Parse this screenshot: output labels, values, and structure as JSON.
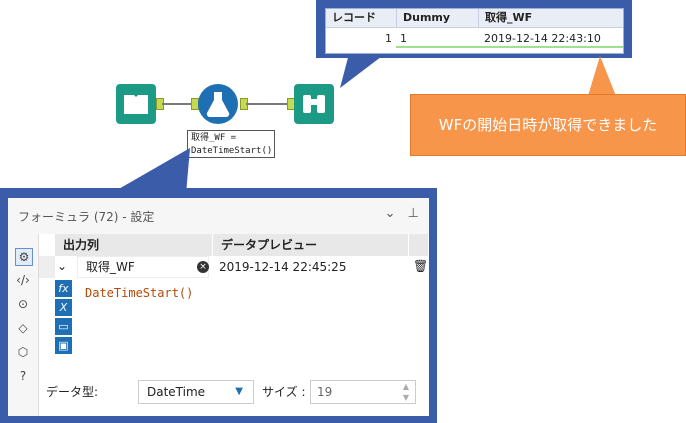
{
  "results": {
    "columns": [
      "レコード",
      "Dummy",
      "取得_WF"
    ],
    "rows": [
      {
        "record": "1",
        "dummy": "1",
        "value": "2019-12-14 22:43:10"
      }
    ]
  },
  "note": "WFの開始日時が取得できました",
  "annotation": {
    "line1": "取得_WF =",
    "line2": "DateTimeStart()"
  },
  "config": {
    "title": "フォーミュラ (72) - 設定",
    "header_output": "出力列",
    "header_preview": "データプレビュー",
    "row": {
      "column": "取得_WF",
      "preview": "2019-12-14 22:45:25"
    },
    "expression": "DateTimeStart()",
    "datatype_label": "データ型:",
    "datatype_value": "DateTime",
    "size_label": "サイズ :",
    "size_value": "19"
  },
  "colors": {
    "frame": "#3b5ca8",
    "note": "#f7954a",
    "tool_teal": "#1d9a85",
    "tool_blue": "#1f6fb5"
  },
  "icons": [
    "gear-icon",
    "code-icon",
    "arrow-icon",
    "tag-icon",
    "cube-icon",
    "help-icon",
    "pin-icon",
    "chevron-down-icon",
    "trash-icon"
  ]
}
